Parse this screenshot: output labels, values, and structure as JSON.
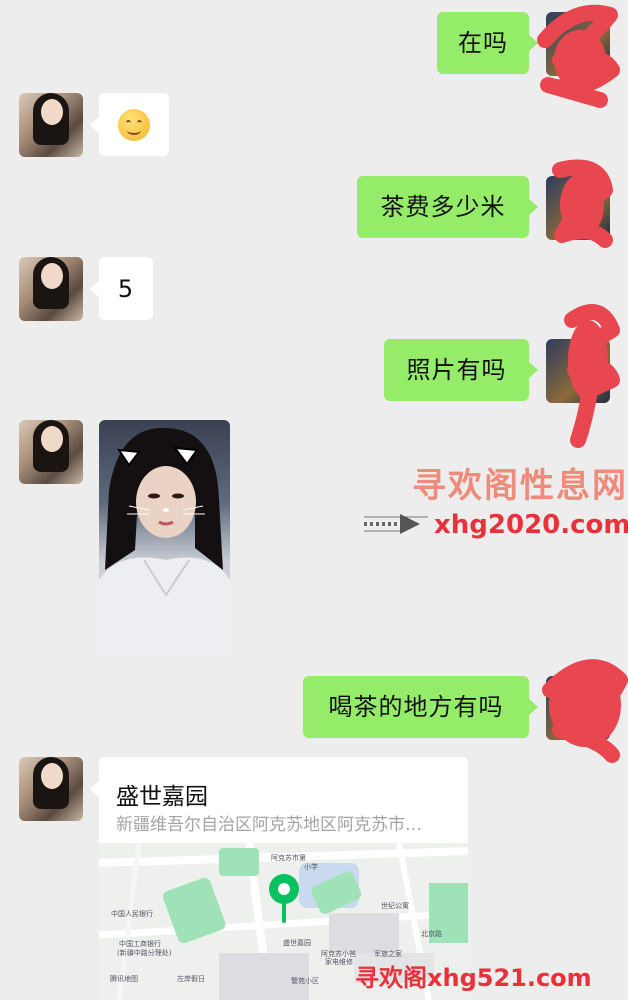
{
  "messages": {
    "m1": "在吗",
    "m2_emoji": "smiling-face-emoji",
    "m3": "茶费多少米",
    "m4": "5",
    "m5": "照片有吗",
    "m7": "喝茶的地方有吗"
  },
  "location": {
    "name": "盛世嘉园",
    "address": "新疆维吾尔自治区阿克苏地区阿克苏市…",
    "map_labels": {
      "l1": "中国人民银行",
      "l2": "中国工商银行",
      "l3": "(新疆中路分理处)",
      "l4": "阿克苏市第",
      "l5": "小学",
      "l6": "世纪公寓",
      "l7": "盛世嘉园",
      "l8": "阿克苏小爸",
      "l9": "家电维修",
      "l10": "军旅之家",
      "l11": "北京路",
      "l12": "左岸假日",
      "l13": "警苑小区",
      "l14": "腾讯地图"
    }
  },
  "watermarks": {
    "title": "寻欢阁性息网",
    "url": "xhg2020.com",
    "bottom": "寻欢阁xhg521.com"
  },
  "colors": {
    "my_bubble": "#95ec69",
    "their_bubble": "#ffffff",
    "background": "#ededed",
    "scribble": "#e8474f",
    "map_pin": "#07c160"
  }
}
